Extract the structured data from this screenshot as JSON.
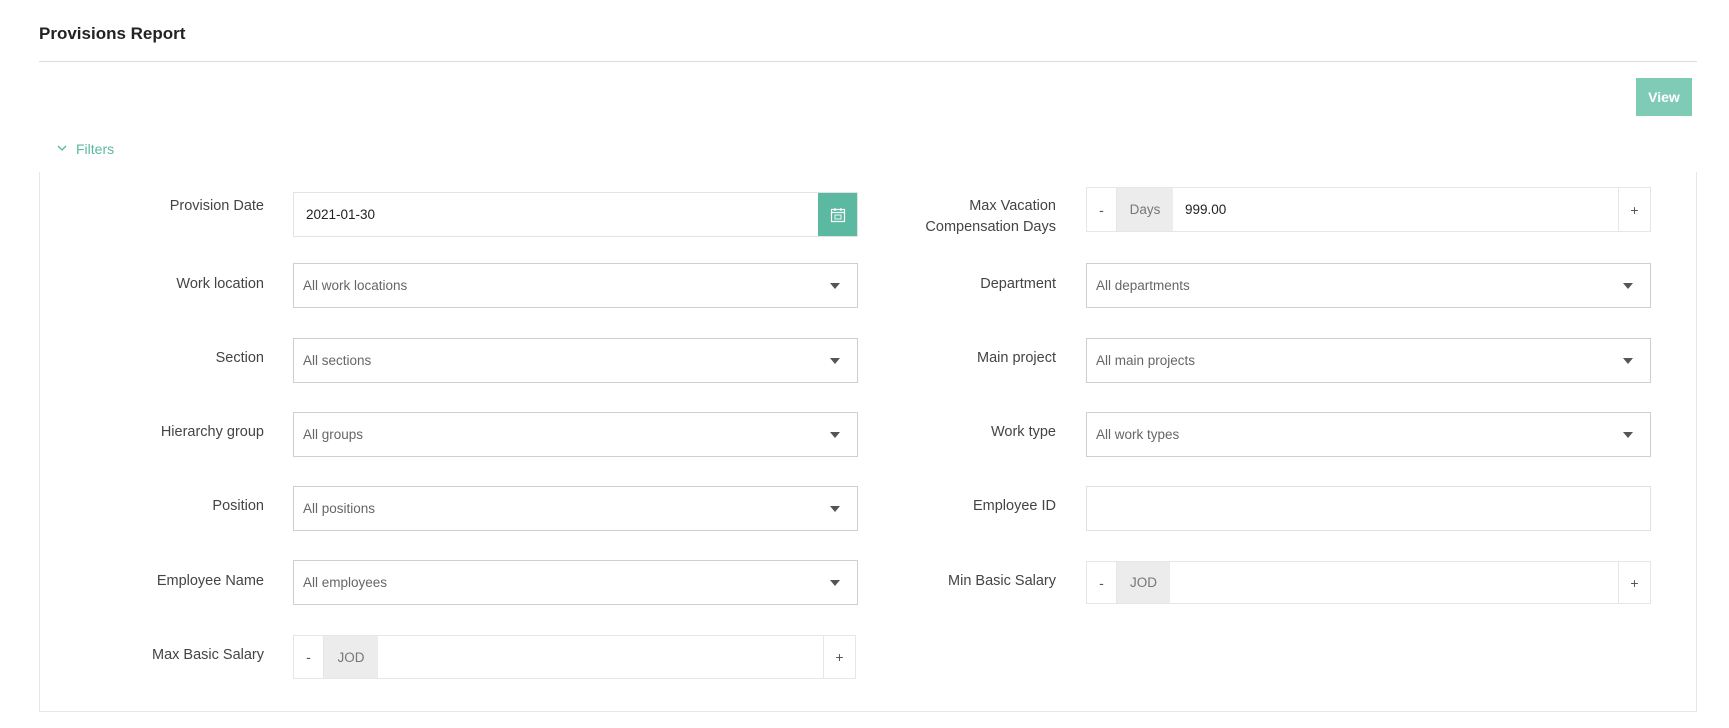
{
  "header": {
    "title": "Provisions Report"
  },
  "actions": {
    "view_label": "View"
  },
  "filters": {
    "toggle_label": "Filters",
    "provision_date": {
      "label": "Provision Date",
      "value": "2021-01-30"
    },
    "max_vacation": {
      "label_line1": "Max Vacation",
      "label_line2": "Compensation Days",
      "minus": "-",
      "unit": "Days",
      "value": "999.00",
      "plus": "+"
    },
    "work_location": {
      "label": "Work location",
      "placeholder": "All work locations"
    },
    "department": {
      "label": "Department",
      "placeholder": "All departments"
    },
    "section": {
      "label": "Section",
      "placeholder": "All sections"
    },
    "main_project": {
      "label": "Main project",
      "placeholder": "All main projects"
    },
    "hierarchy_group": {
      "label": "Hierarchy group",
      "placeholder": "All groups"
    },
    "work_type": {
      "label": "Work type",
      "placeholder": "All work types"
    },
    "position": {
      "label": "Position",
      "placeholder": "All positions"
    },
    "employee_id": {
      "label": "Employee ID",
      "value": ""
    },
    "employee_name": {
      "label": "Employee Name",
      "placeholder": "All employees"
    },
    "min_basic_salary": {
      "label": "Min Basic Salary",
      "minus": "-",
      "unit": "JOD",
      "value": "",
      "plus": "+"
    },
    "max_basic_salary": {
      "label": "Max Basic Salary",
      "minus": "-",
      "unit": "JOD",
      "value": "",
      "plus": "+"
    }
  },
  "colors": {
    "accent": "#5ab9a0",
    "button": "#7fcbb6"
  },
  "icons": {
    "filters_toggle": "chevron-down-icon",
    "date_picker": "calendar-icon",
    "dropdown": "caret-down-icon"
  }
}
